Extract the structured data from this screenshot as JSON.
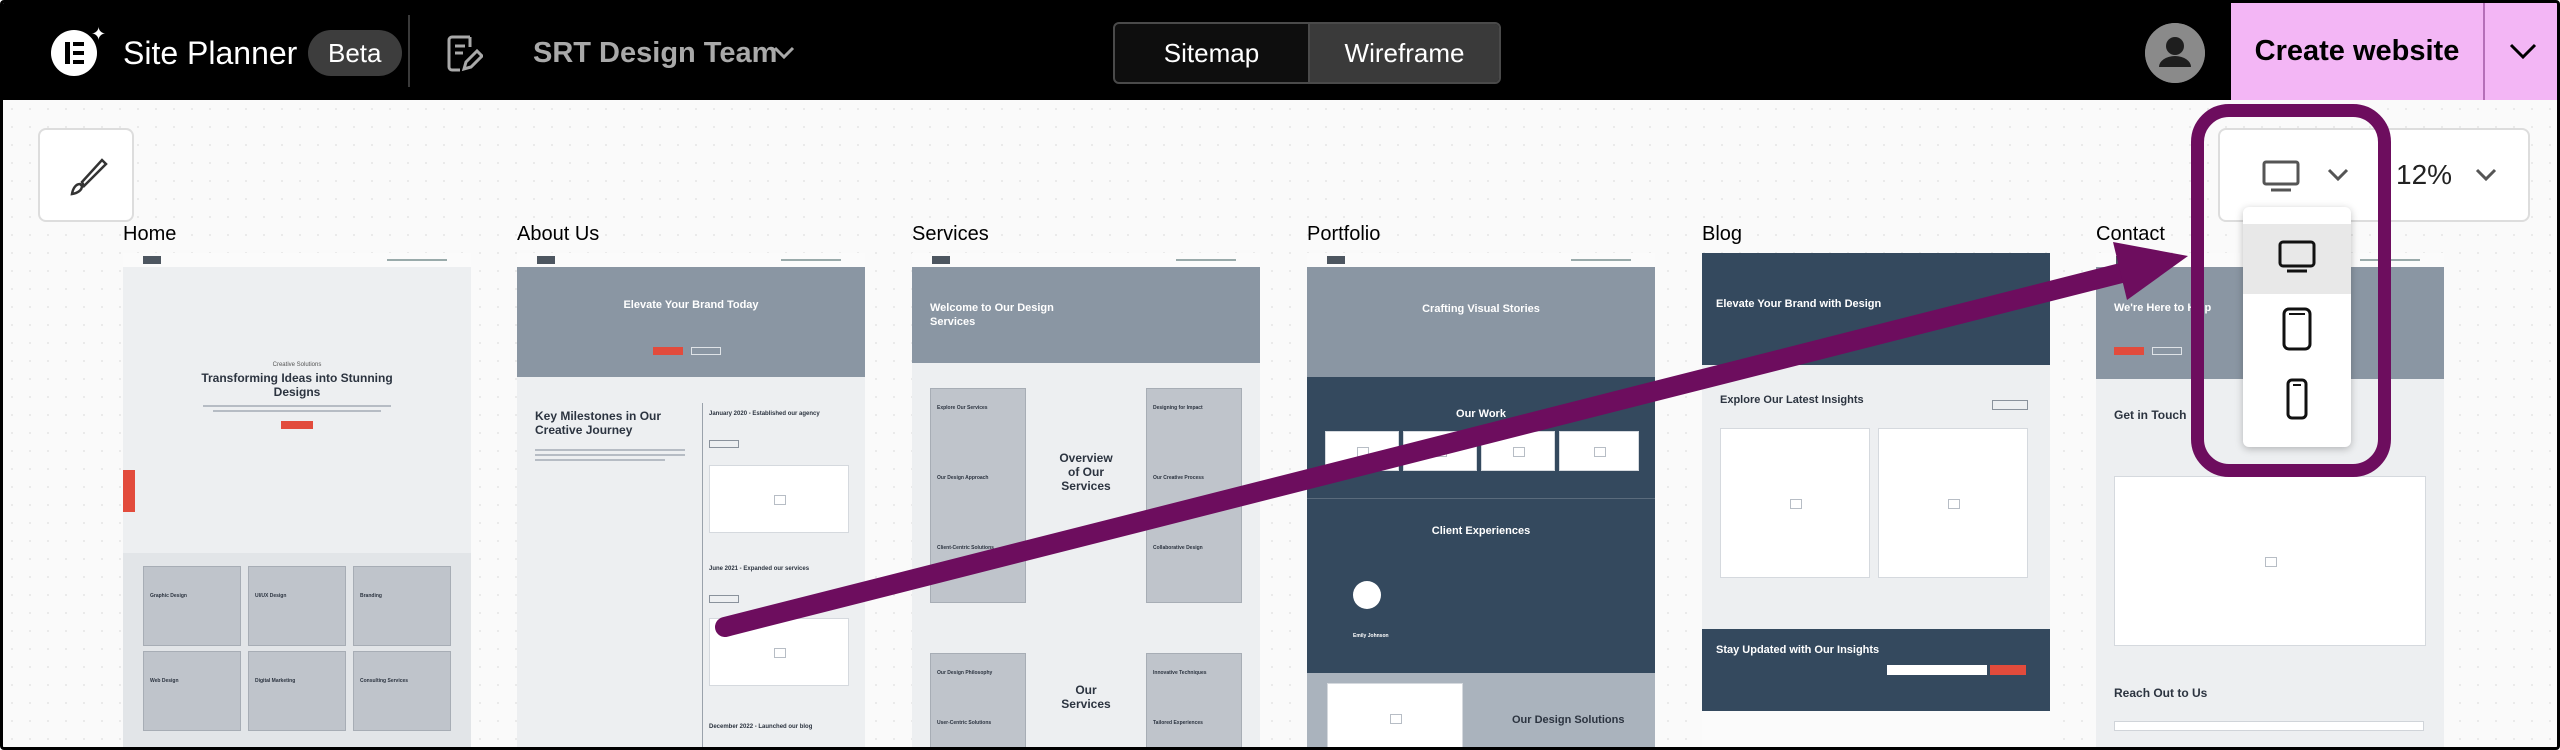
{
  "app": {
    "title": "Site Planner",
    "badge": "Beta"
  },
  "workspace": {
    "name": "SRT Design Team"
  },
  "view_tabs": [
    {
      "label": "Sitemap",
      "active": false
    },
    {
      "label": "Wireframe",
      "active": true
    }
  ],
  "actions": {
    "create_label": "Create website"
  },
  "toolbar": {
    "zoom": "12%",
    "device_selected": "desktop",
    "device_options": [
      "desktop",
      "tablet",
      "mobile"
    ]
  },
  "pages": [
    {
      "label": "Home",
      "hero_kicker": "Creative Solutions",
      "hero_title": "Transforming Ideas into Stunning Designs",
      "cards": [
        "Graphic Design",
        "UI/UX Design",
        "Branding",
        "Web Design",
        "Digital Marketing",
        "Consulting Services"
      ]
    },
    {
      "label": "About Us",
      "hero_title": "Elevate Your Brand Today",
      "section_title": "Key Milestones in Our Creative Journey",
      "milestones": [
        "January 2020 - Established our agency",
        "June 2021 - Expanded our services",
        "December 2022 - Launched our blog"
      ]
    },
    {
      "label": "Services",
      "hero_title": "Welcome to Our Design Services",
      "overview_title": "Overview of Our Services",
      "left_items": [
        "Explore Our Services",
        "Our Design Approach",
        "Client-Centric Solutions"
      ],
      "right_items": [
        "Designing for Impact",
        "Our Creative Process",
        "Collaborative Design"
      ],
      "services_title": "Our Services",
      "left_items_2": [
        "Our Design Philosophy",
        "User-Centric Solutions"
      ],
      "right_items_2": [
        "Innovative Techniques",
        "Tailored Experiences"
      ]
    },
    {
      "label": "Portfolio",
      "hero_title": "Crafting Visual Stories",
      "work_title": "Our Work",
      "experiences_title": "Client Experiences",
      "testimonial_name": "Emily Johnson",
      "solutions_title": "Our Design Solutions"
    },
    {
      "label": "Blog",
      "hero_title": "Elevate Your Brand with Design",
      "insights_title": "Explore Our Latest Insights",
      "updated_title": "Stay Updated with Our Insights"
    },
    {
      "label": "Contact",
      "hero_title": "We're Here to Help",
      "touch_title": "Get in Touch",
      "reach_title": "Reach Out to Us"
    }
  ],
  "colors": {
    "brand_accent": "#f3b6f5",
    "annotation": "#6d0d5e",
    "hero_dark": "#34495e",
    "hero_gray": "#8a96a3",
    "cta_red": "#e24b3c"
  }
}
